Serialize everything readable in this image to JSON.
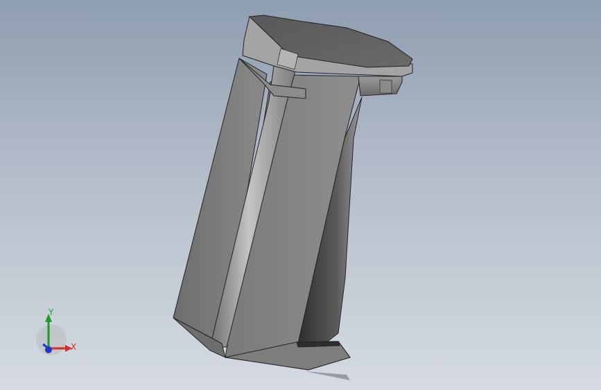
{
  "viewport": {
    "background_top": "#8f9db1",
    "background_bottom": "#d6dbe2"
  },
  "model": {
    "name": "",
    "body_color": "#7c7c7c",
    "shadow_color": "#3b3b3b",
    "highlight_color": "#b9b9b9"
  },
  "triad": {
    "x_label": "X",
    "y_label": "Y",
    "x_color": "#d42b2b",
    "y_color": "#1e9a2c",
    "z_color": "#1e38c8"
  }
}
